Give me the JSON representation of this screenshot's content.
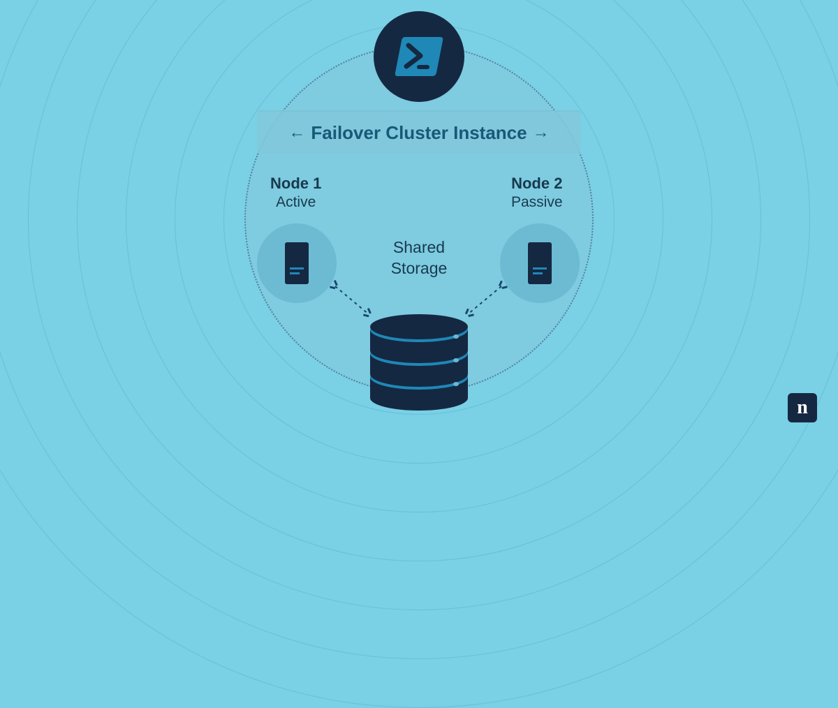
{
  "title": "Failover Cluster Instance",
  "nodes": [
    {
      "name": "Node 1",
      "state": "Active"
    },
    {
      "name": "Node 2",
      "state": "Passive"
    }
  ],
  "shared_label_line1": "Shared",
  "shared_label_line2": "Storage",
  "logo_letter": "n",
  "colors": {
    "bg": "#7ad0e5",
    "dark": "#152842",
    "accent": "#1f88b7",
    "text": "#173a4e"
  }
}
